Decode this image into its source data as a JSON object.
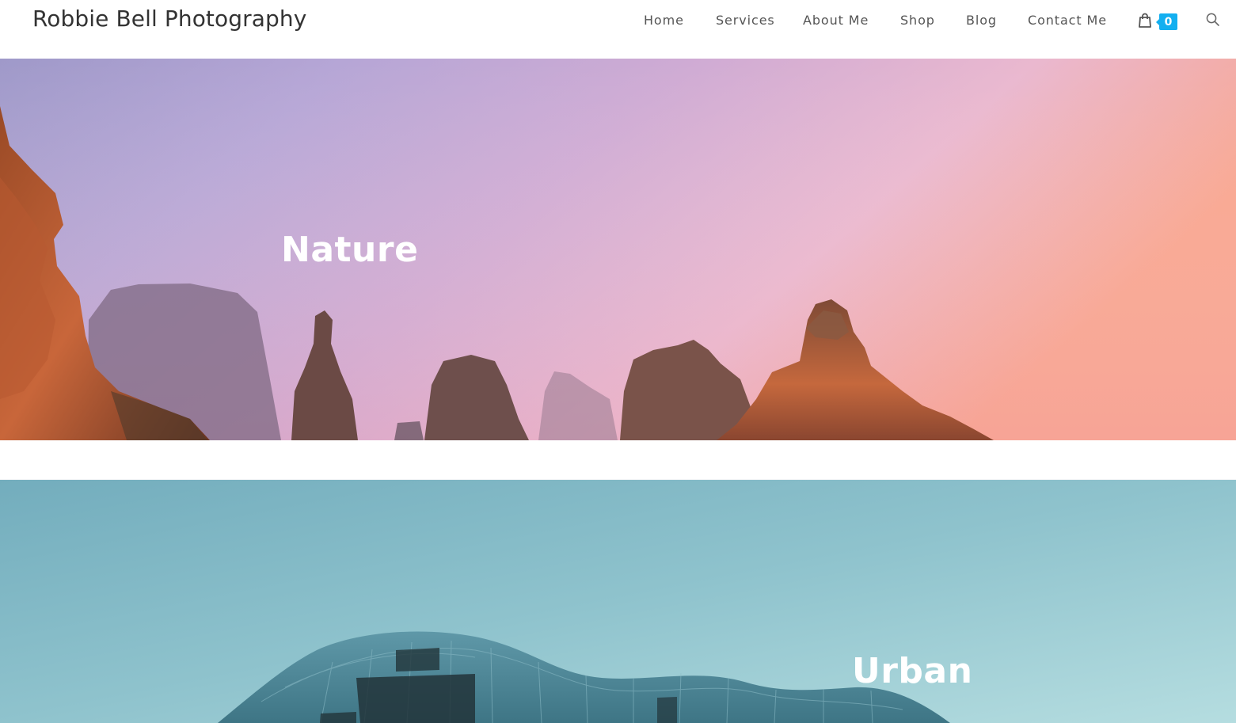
{
  "site": {
    "title": "Robbie Bell Photography"
  },
  "nav": {
    "items": [
      {
        "label": "Home"
      },
      {
        "label": "Services"
      },
      {
        "label": "About Me"
      },
      {
        "label": "Shop"
      },
      {
        "label": "Blog"
      },
      {
        "label": "Contact Me"
      }
    ],
    "cart": {
      "icon": "shopping-bag-icon",
      "count": "0",
      "badge_color": "#13aff0"
    },
    "search": {
      "icon": "search-icon"
    }
  },
  "sections": [
    {
      "heading": "Nature",
      "image": "foggy-rock-pinnacles-at-sunset"
    },
    {
      "heading": "Urban",
      "image": "curved-glass-building-against-blue-sky"
    }
  ],
  "colors": {
    "text": "#333333",
    "nav_text": "#555555",
    "accent": "#13aff0",
    "nature_sky_left": "#a79fd0",
    "nature_sky_right": "#f7a68a",
    "urban_sky": "#8ec2cc"
  }
}
